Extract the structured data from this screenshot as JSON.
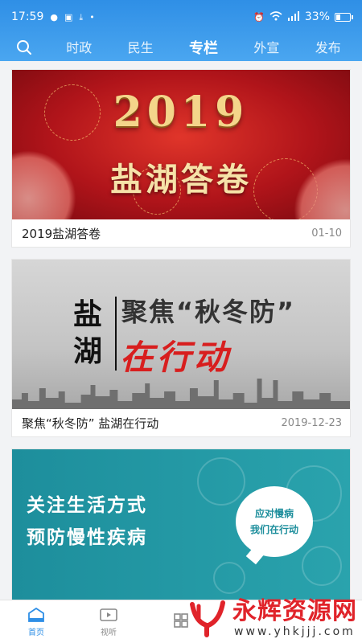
{
  "status_bar": {
    "time": "17:59",
    "battery_text": "33%",
    "battery_level": 0.33,
    "icons": [
      "location-icon",
      "image-icon",
      "download-icon",
      "dot-icon",
      "alarm-icon",
      "wifi-icon",
      "signal-icon",
      "battery-icon"
    ]
  },
  "nav": {
    "search_icon": "search-icon",
    "tabs": [
      {
        "label": "时政"
      },
      {
        "label": "民生"
      },
      {
        "label": "专栏"
      },
      {
        "label": "外宣"
      },
      {
        "label": "发布"
      }
    ],
    "active_tab": 2
  },
  "cards": [
    {
      "image": {
        "headline": "2019",
        "subline": "盐湖答卷"
      },
      "title": "2019盐湖答卷",
      "date": "01-10"
    },
    {
      "image": {
        "vertical": [
          "盐",
          "湖"
        ],
        "focus": "聚焦“秋冬防”",
        "action": "在行动"
      },
      "title": "聚焦“秋冬防” 盐湖在行动",
      "date": "2019-12-23"
    },
    {
      "image": {
        "line1": "关注生活方式",
        "line2": "预防慢性疾病",
        "bubble1": "应对慢病",
        "bubble2": "我们在行动"
      }
    }
  ],
  "bottom_nav": [
    {
      "label": "首页",
      "icon": "home-icon"
    },
    {
      "label": "视听",
      "icon": "video-icon"
    },
    {
      "label": "",
      "icon": "grid-icon"
    }
  ],
  "watermark": {
    "title": "永辉资源网",
    "url": "www.yhkjjj.com"
  },
  "colors": {
    "header": "#2f8fe6",
    "accent_red": "#d81e1e",
    "teal": "#1d8e9c"
  }
}
